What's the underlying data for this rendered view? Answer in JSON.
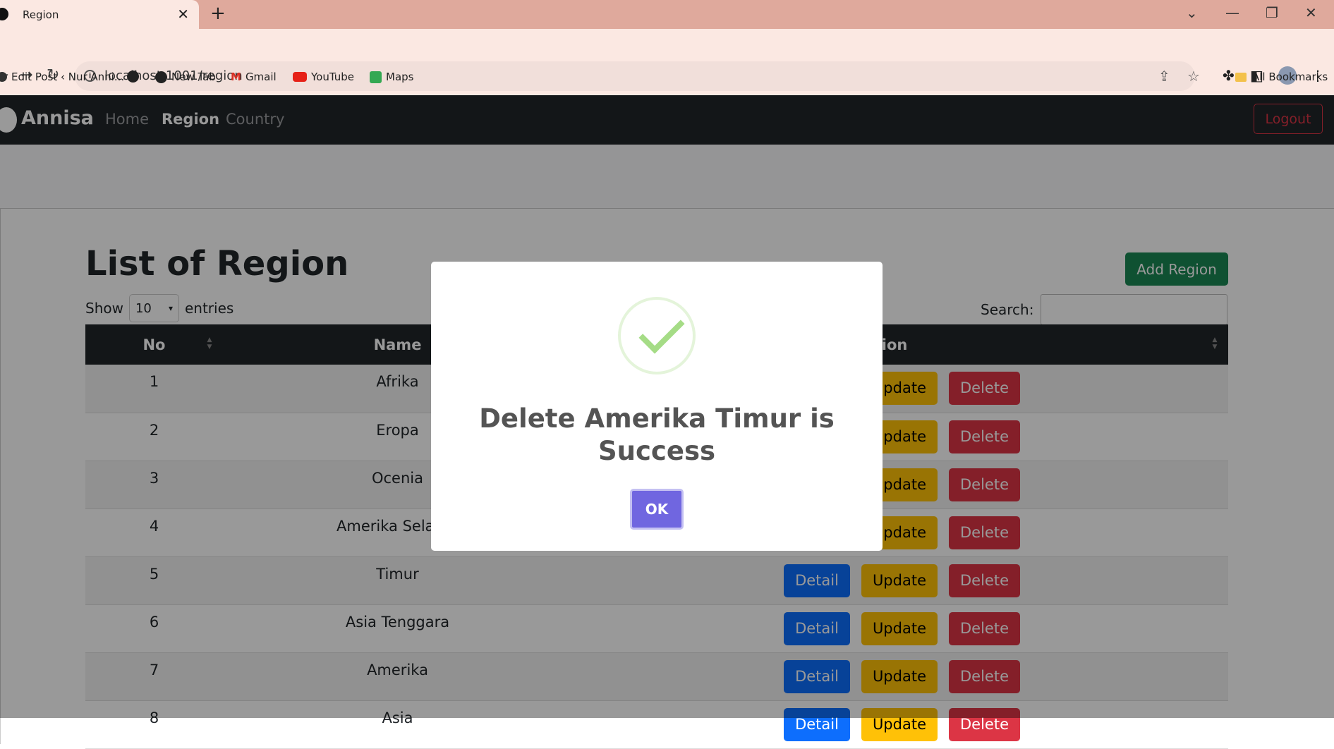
{
  "browser": {
    "tab_title": "Region",
    "url": "localhost:1001/region",
    "bookmarks": [
      {
        "label": "Edit Post ‹ Nur Anni...",
        "icon": "wordpress-icon"
      },
      {
        "label": "",
        "icon": "globe-icon"
      },
      {
        "label": "New Tab",
        "icon": "globe-icon"
      },
      {
        "label": "Gmail",
        "icon": "gmail-icon"
      },
      {
        "label": "YouTube",
        "icon": "youtube-icon"
      },
      {
        "label": "Maps",
        "icon": "maps-icon"
      }
    ],
    "all_bookmarks": "All Bookmarks"
  },
  "navbar": {
    "brand": "Annisa",
    "links": [
      "Home",
      "Region",
      "Country"
    ],
    "active": "Region",
    "logout": "Logout"
  },
  "main": {
    "title": "List of Region",
    "add_button": "Add Region",
    "show_label": "Show",
    "entries_value": "10",
    "entries_label": "entries",
    "search_label": "Search:",
    "columns": [
      "No",
      "Name",
      "Action"
    ],
    "rows": [
      {
        "no": "1",
        "name": "Afrika"
      },
      {
        "no": "2",
        "name": "Eropa"
      },
      {
        "no": "3",
        "name": "Ocenia"
      },
      {
        "no": "4",
        "name": "Amerika Selatan"
      },
      {
        "no": "5",
        "name": "Timur"
      },
      {
        "no": "6",
        "name": "Asia Tenggara"
      },
      {
        "no": "7",
        "name": "Amerika"
      },
      {
        "no": "8",
        "name": "Asia"
      }
    ],
    "actions": {
      "detail": "Detail",
      "update": "Update",
      "delete": "Delete"
    }
  },
  "modal": {
    "message": "Delete Amerika Timur is Success",
    "ok": "OK",
    "icon": "success-check-icon"
  },
  "colors": {
    "navbar": "#212529",
    "success": "#198754",
    "primary": "#0d6efd",
    "warning": "#ffc107",
    "danger": "#dc3545",
    "confirm": "#7066e0"
  }
}
